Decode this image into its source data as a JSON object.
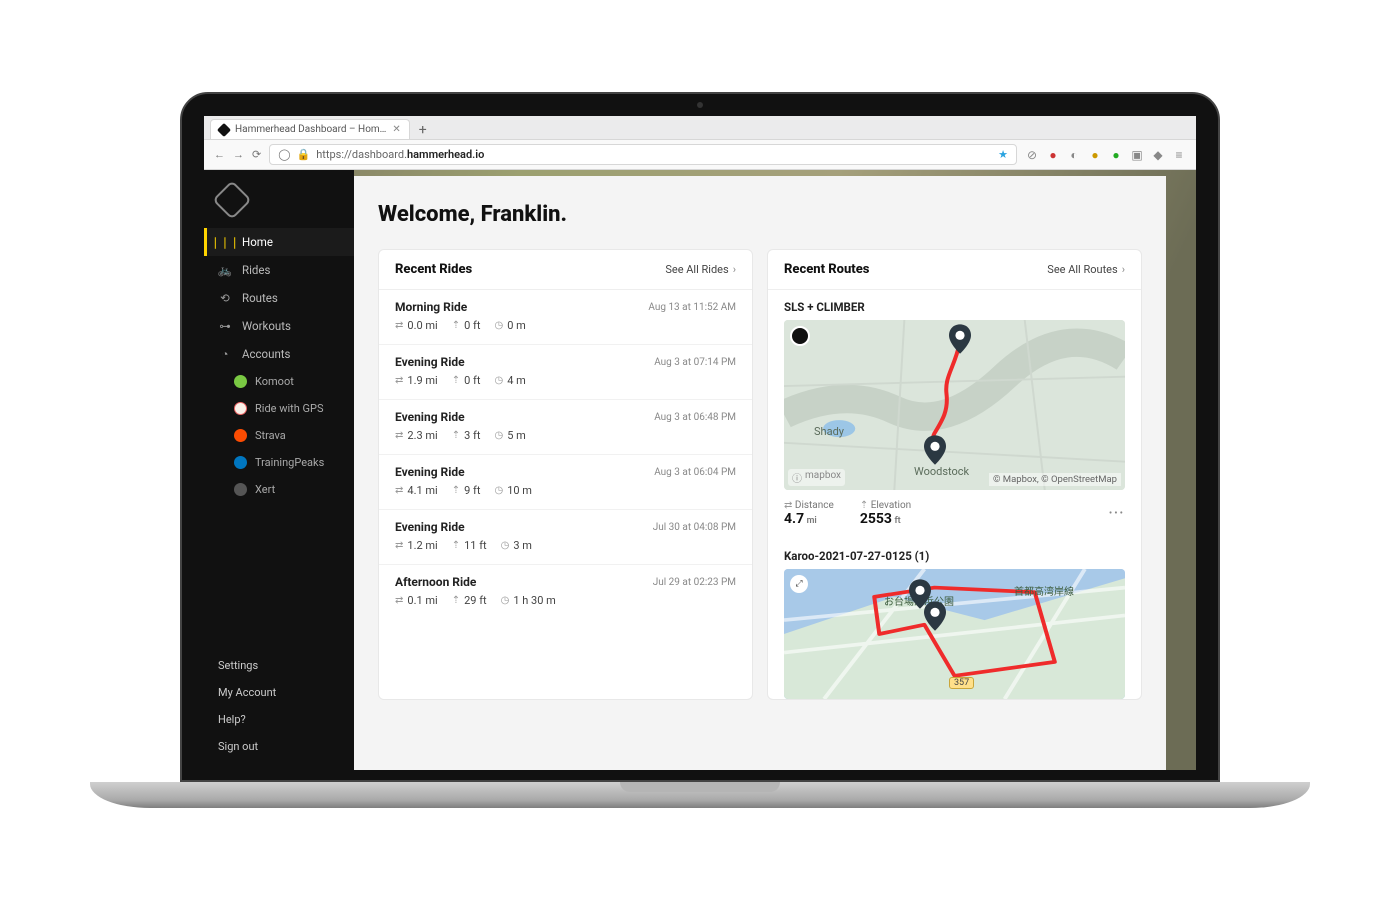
{
  "browser": {
    "tab_title": "Hammerhead Dashboard – Hom…",
    "url_prefix": "https://dashboard.",
    "url_host": "hammerhead.io"
  },
  "sidebar": {
    "nav": [
      {
        "label": "Home",
        "icon": "bars"
      },
      {
        "label": "Rides",
        "icon": "bike"
      },
      {
        "label": "Routes",
        "icon": "route"
      },
      {
        "label": "Workouts",
        "icon": "dumbbell"
      },
      {
        "label": "Accounts",
        "icon": "circle"
      }
    ],
    "accounts": [
      {
        "label": "Komoot",
        "color": "#7ac943"
      },
      {
        "label": "Ride with GPS",
        "color": "#f47b3e"
      },
      {
        "label": "Strava",
        "color": "#fc4c02"
      },
      {
        "label": "TrainingPeaks",
        "color": "#0076c0"
      },
      {
        "label": "Xert",
        "color": "#6b6b6b"
      }
    ],
    "footer": [
      "Settings",
      "My Account",
      "Help?",
      "Sign out"
    ]
  },
  "welcome": "Welcome, Franklin.",
  "recent_rides": {
    "title": "Recent Rides",
    "see_all": "See All Rides",
    "items": [
      {
        "name": "Morning Ride",
        "time": "Aug 13 at 11:52 AM",
        "dist": "0.0 mi",
        "elev": "0 ft",
        "dur": "0 m"
      },
      {
        "name": "Evening Ride",
        "time": "Aug 3 at 07:14 PM",
        "dist": "1.9 mi",
        "elev": "0 ft",
        "dur": "4 m"
      },
      {
        "name": "Evening Ride",
        "time": "Aug 3 at 06:48 PM",
        "dist": "2.3 mi",
        "elev": "3 ft",
        "dur": "5 m"
      },
      {
        "name": "Evening Ride",
        "time": "Aug 3 at 06:04 PM",
        "dist": "4.1 mi",
        "elev": "9 ft",
        "dur": "10 m"
      },
      {
        "name": "Evening Ride",
        "time": "Jul 30 at 04:08 PM",
        "dist": "1.2 mi",
        "elev": "11 ft",
        "dur": "3 m"
      },
      {
        "name": "Afternoon Ride",
        "time": "Jul 29 at 02:23 PM",
        "dist": "0.1 mi",
        "elev": "29 ft",
        "dur": "1 h 30 m"
      }
    ]
  },
  "recent_routes": {
    "title": "Recent Routes",
    "see_all": "See All Routes",
    "mapbox": "mapbox",
    "attrib": "© Mapbox, © OpenStreetMap",
    "route1": {
      "name": "SLS + CLIMBER",
      "place1": "Shady",
      "place2": "Woodstock",
      "distance_label": "Distance",
      "distance_value": "4.7",
      "distance_unit": "mi",
      "elev_label": "Elevation",
      "elev_value": "2553",
      "elev_unit": "ft"
    },
    "route2": {
      "name": "Karoo-2021-07-27-0125 (1)",
      "place1": "お台場海浜公園",
      "place2": "首都高湾岸線",
      "roadnum": "357"
    }
  }
}
